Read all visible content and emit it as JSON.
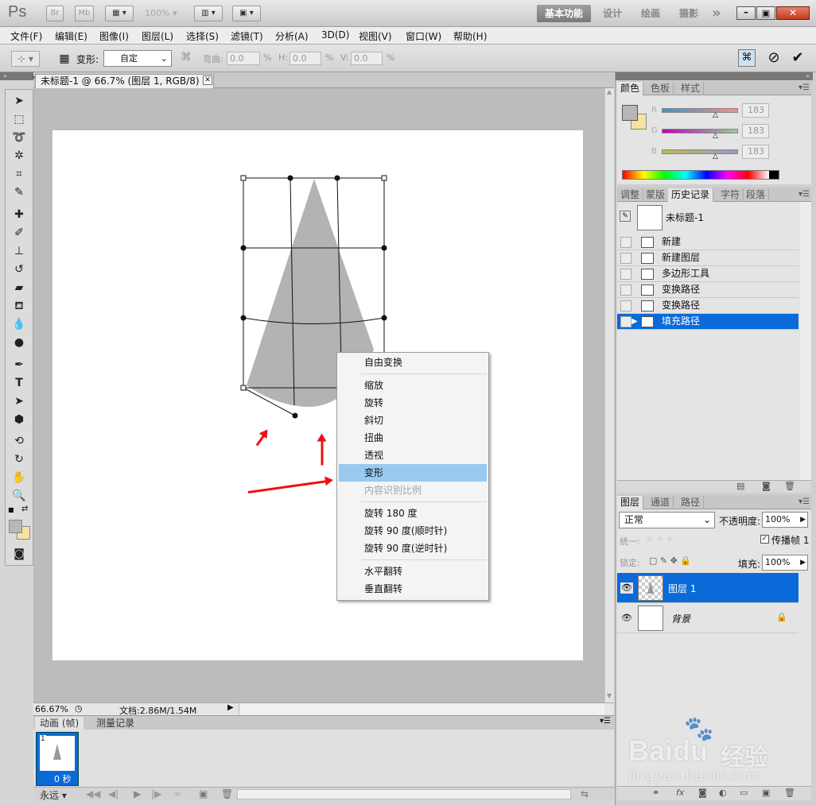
{
  "titlebar": {
    "ps_logo": "Ps",
    "br": "Br",
    "mb": "Mb",
    "zoom": "100%",
    "workspace_active": "基本功能",
    "workspace_items": [
      "设计",
      "绘画",
      "摄影"
    ],
    "more": "»"
  },
  "menubar": [
    "文件(F)",
    "编辑(E)",
    "图像(I)",
    "图层(L)",
    "选择(S)",
    "滤镜(T)",
    "分析(A)",
    "3D(D)",
    "视图(V)",
    "窗口(W)",
    "帮助(H)"
  ],
  "options": {
    "warp_label": "变形:",
    "warp_value": "自定",
    "bend_label": "弯曲:",
    "bend_value": "0.0",
    "h_label": "H:",
    "h_value": "0.0",
    "v_label": "V:",
    "v_value": "0.0",
    "pct": "%"
  },
  "document": {
    "tab_title": "未标题-1 @ 66.7% (图层 1, RGB/8) *",
    "zoom": "66.67%",
    "doc_info": "文档:2.86M/1.54M"
  },
  "context_menu": {
    "items": [
      {
        "label": "自由变换",
        "state": "normal"
      },
      {
        "label": "缩放",
        "state": "normal"
      },
      {
        "label": "旋转",
        "state": "normal"
      },
      {
        "label": "斜切",
        "state": "normal"
      },
      {
        "label": "扭曲",
        "state": "normal"
      },
      {
        "label": "透视",
        "state": "normal"
      },
      {
        "label": "变形",
        "state": "selected"
      },
      {
        "label": "内容识别比例",
        "state": "disabled"
      },
      {
        "label": "旋转 180 度",
        "state": "normal"
      },
      {
        "label": "旋转 90 度(顺时针)",
        "state": "normal"
      },
      {
        "label": "旋转 90 度(逆时针)",
        "state": "normal"
      },
      {
        "label": "水平翻转",
        "state": "normal"
      },
      {
        "label": "垂直翻转",
        "state": "normal"
      }
    ]
  },
  "animation_panel": {
    "tabs": [
      "动画 (帧)",
      "测量记录"
    ],
    "frame_number": "1",
    "frame_time": "0 秒",
    "loop": "永远"
  },
  "color_panel": {
    "tabs": [
      "颜色",
      "色板",
      "样式"
    ],
    "channels": [
      {
        "label": "R",
        "value": "183",
        "color": "#d88080"
      },
      {
        "label": "G",
        "value": "183",
        "color": "#b040b0"
      },
      {
        "label": "B",
        "value": "183",
        "color": "#b0b060"
      }
    ],
    "foreground": "#b7b7b7",
    "background": "#f4e3a1"
  },
  "history_panel": {
    "tabs": [
      "调整",
      "蒙版",
      "历史记录",
      "字符",
      "段落"
    ],
    "snapshot": "未标题-1",
    "items": [
      "新建",
      "新建图层",
      "多边形工具",
      "变换路径",
      "变换路径",
      "填充路径"
    ],
    "selected_index": 5
  },
  "layers_panel": {
    "tabs": [
      "图层",
      "通道",
      "路径"
    ],
    "blend_mode": "正常",
    "opacity_label": "不透明度:",
    "opacity_value": "100%",
    "unify_label": "统一:",
    "propagate_label": "传播帧 1",
    "lock_label": "锁定:",
    "fill_label": "填充:",
    "fill_value": "100%",
    "layers": [
      {
        "name": "图层 1",
        "selected": true
      },
      {
        "name": "背景",
        "selected": false
      }
    ]
  },
  "watermark": {
    "brand": "Bai",
    "brand2": "du",
    "cn": "经验",
    "url": "jingyan.baidu.com"
  }
}
